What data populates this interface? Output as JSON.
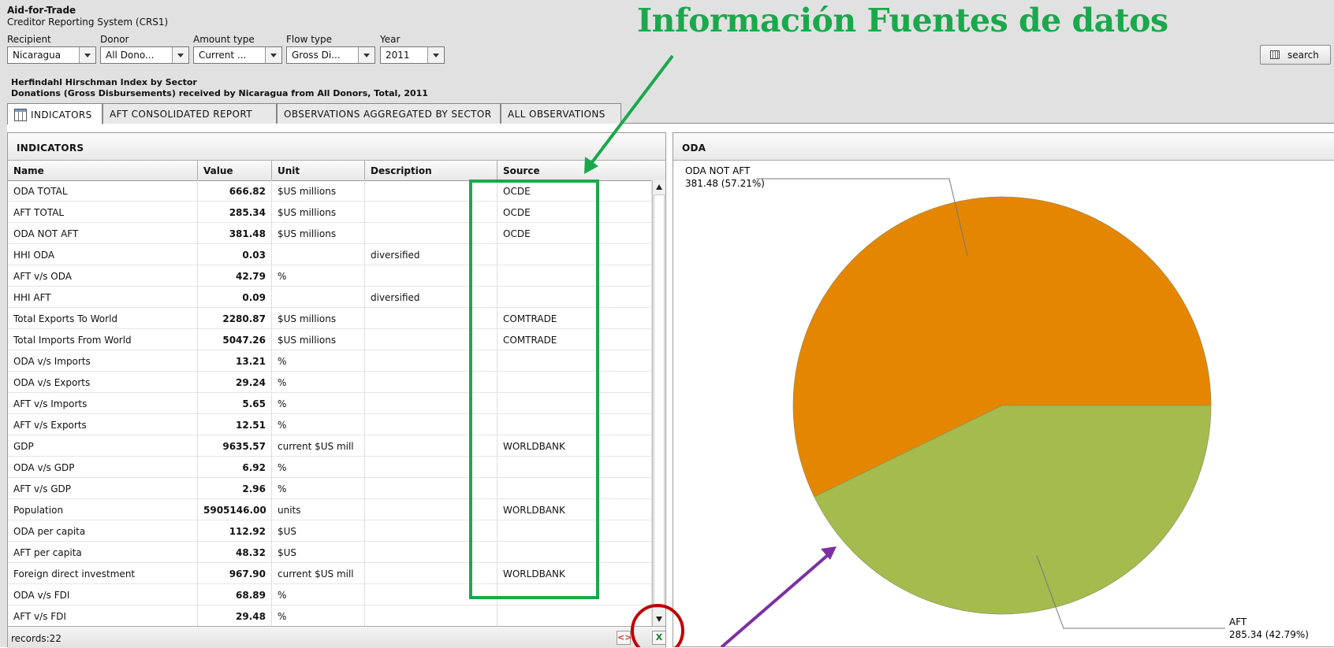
{
  "app": {
    "title": "Aid-for-Trade",
    "subtitle": "Creditor Reporting System (CRS1)"
  },
  "filters": [
    {
      "label": "Recipient",
      "value": "Nicaragua"
    },
    {
      "label": "Donor",
      "value": "All Dono..."
    },
    {
      "label": "Amount type",
      "value": "Current ..."
    },
    {
      "label": "Flow type",
      "value": "Gross Di..."
    },
    {
      "label": "Year",
      "value": "2011"
    }
  ],
  "search_label": "search",
  "report": {
    "title": "Herfindahl Hirschman Index by Sector",
    "subtitle": "Donations (Gross Disbursements) received by Nicaragua from All Donors, Total, 2011"
  },
  "tabs": [
    "INDICATORS",
    "AFT CONSOLIDATED REPORT",
    "OBSERVATIONS AGGREGATED BY SECTOR",
    "ALL OBSERVATIONS"
  ],
  "indicators": {
    "panel_title": "INDICATORS",
    "columns": [
      "Name",
      "Value",
      "Unit",
      "Description",
      "Source"
    ],
    "rows": [
      [
        "ODA TOTAL",
        "666.82",
        "$US millions",
        "",
        "OCDE"
      ],
      [
        "AFT TOTAL",
        "285.34",
        "$US millions",
        "",
        "OCDE"
      ],
      [
        "ODA NOT AFT",
        "381.48",
        "$US millions",
        "",
        "OCDE"
      ],
      [
        "HHI ODA",
        "0.03",
        "",
        "diversified",
        ""
      ],
      [
        "AFT v/s ODA",
        "42.79",
        "%",
        "",
        ""
      ],
      [
        "HHI AFT",
        "0.09",
        "",
        "diversified",
        ""
      ],
      [
        "Total Exports To World",
        "2280.87",
        "$US millions",
        "",
        "COMTRADE"
      ],
      [
        "Total Imports From World",
        "5047.26",
        "$US millions",
        "",
        "COMTRADE"
      ],
      [
        "ODA v/s Imports",
        "13.21",
        "%",
        "",
        ""
      ],
      [
        "ODA v/s Exports",
        "29.24",
        "%",
        "",
        ""
      ],
      [
        "AFT v/s Imports",
        "5.65",
        "%",
        "",
        ""
      ],
      [
        "AFT v/s Exports",
        "12.51",
        "%",
        "",
        ""
      ],
      [
        "GDP",
        "9635.57",
        "current $US mill",
        "",
        "WORLDBANK"
      ],
      [
        "ODA v/s GDP",
        "6.92",
        "%",
        "",
        ""
      ],
      [
        "AFT v/s GDP",
        "2.96",
        "%",
        "",
        ""
      ],
      [
        "Population",
        "5905146.00",
        "units",
        "",
        "WORLDBANK"
      ],
      [
        "ODA per capita",
        "112.92",
        "$US",
        "",
        ""
      ],
      [
        "AFT per capita",
        "48.32",
        "$US",
        "",
        ""
      ],
      [
        "Foreign direct investment",
        "967.90",
        "current $US mill",
        "",
        "WORLDBANK"
      ],
      [
        "ODA v/s FDI",
        "68.89",
        "%",
        "",
        ""
      ],
      [
        "AFT v/s FDI",
        "29.48",
        "%",
        "",
        ""
      ]
    ],
    "records_label": "records:22"
  },
  "oda_panel_title": "ODA",
  "chart_data": {
    "type": "pie",
    "slices": [
      {
        "label": "ODA NOT AFT",
        "value": 381.48,
        "percent": 57.21,
        "text": "381.48 (57.21%)",
        "color": "#e58600"
      },
      {
        "label": "AFT",
        "value": 285.34,
        "percent": 42.79,
        "text": "285.34 (42.79%)",
        "color": "#a4bb4e"
      }
    ]
  },
  "annotation": {
    "headline": "Información Fuentes de datos",
    "color": "#1aa84c"
  },
  "colors": {
    "highlight_box": "#1aa84c",
    "purple_arrow": "#7b32a0",
    "circle": "#c00000"
  }
}
